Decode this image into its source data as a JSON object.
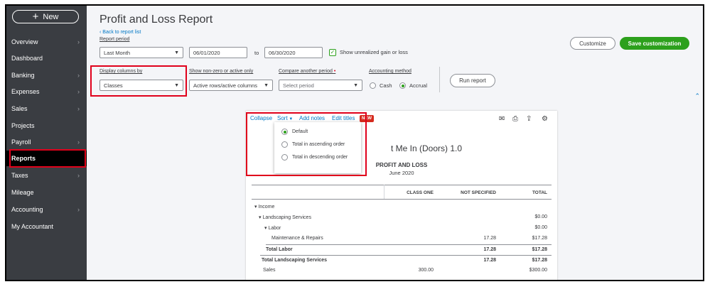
{
  "sidebar": {
    "new_label": "New",
    "items": [
      {
        "label": "Overview",
        "chevron": true
      },
      {
        "label": "Dashboard",
        "chevron": false
      },
      {
        "label": "Banking",
        "chevron": true
      },
      {
        "label": "Expenses",
        "chevron": true
      },
      {
        "label": "Sales",
        "chevron": true
      },
      {
        "label": "Projects",
        "chevron": false
      },
      {
        "label": "Payroll",
        "chevron": true
      },
      {
        "label": "Reports",
        "chevron": false,
        "active": true
      },
      {
        "label": "Taxes",
        "chevron": true
      },
      {
        "label": "Mileage",
        "chevron": false
      },
      {
        "label": "Accounting",
        "chevron": true
      },
      {
        "label": "My Accountant",
        "chevron": false
      }
    ]
  },
  "header": {
    "title": "Profit and Loss Report",
    "back_link": "Back to report list",
    "report_period_label": "Report period",
    "customize_label": "Customize",
    "save_customization_label": "Save customization"
  },
  "filters": {
    "period_value": "Last Month",
    "start_date": "06/01/2020",
    "to_label": "to",
    "end_date": "06/30/2020",
    "show_unrealized_label": "Show unrealized gain or loss",
    "show_unrealized_checked": true,
    "display_columns_label": "Display columns by",
    "display_columns_value": "Classes",
    "show_nonzero_label": "Show non-zero or active only",
    "show_nonzero_value": "Active rows/active columns",
    "compare_label": "Compare another period",
    "compare_required_mark": "•",
    "compare_placeholder": "Select period",
    "accounting_method_label": "Accounting method",
    "method_cash": "Cash",
    "method_accrual": "Accrual",
    "selected_method": "Accrual",
    "run_report_label": "Run report"
  },
  "toolbar": {
    "collapse": "Collapse",
    "sort": "Sort",
    "add_notes": "Add notes",
    "edit_titles": "Edit titles",
    "new_badge": "NEW",
    "icons": [
      "email-icon",
      "print-icon",
      "export-icon",
      "settings-icon"
    ]
  },
  "sort_menu": {
    "options": [
      "Default",
      "Total in ascending order",
      "Total in descending order"
    ],
    "selected": "Default"
  },
  "report": {
    "company_visible": "t Me In (Doors) 1.0",
    "title": "PROFIT AND LOSS",
    "period": "June 2020",
    "columns": [
      "CLASS ONE",
      "NOT SPECIFIED",
      "TOTAL"
    ],
    "rows": [
      {
        "label": "▾ Income",
        "indent": 0,
        "class_one": "",
        "not_specified": "",
        "total": ""
      },
      {
        "label": "▾ Landscaping Services",
        "indent": 1,
        "class_one": "",
        "not_specified": "",
        "total": "$0.00"
      },
      {
        "label": "▾ Labor",
        "indent": 2,
        "class_one": "",
        "not_specified": "",
        "total": "$0.00"
      },
      {
        "label": "Maintenance & Repairs",
        "indent": 3,
        "class_one": "",
        "not_specified": "17.28",
        "total": "$17.28"
      },
      {
        "label": "Total Labor",
        "indent": 3,
        "class_one": "",
        "not_specified": "17.28",
        "total": "$17.28",
        "bold": true
      },
      {
        "label": "Total Landscaping Services",
        "indent": 2,
        "class_one": "",
        "not_specified": "17.28",
        "total": "$17.28",
        "bold": true
      },
      {
        "label": "Sales",
        "indent": 1,
        "class_one": "300.00",
        "not_specified": "",
        "total": "$300.00"
      }
    ]
  },
  "colors": {
    "accent_green": "#2ca01c",
    "link_blue": "#0077c5",
    "highlight_red": "#e0001b",
    "sidebar_bg": "#3a3d42"
  }
}
